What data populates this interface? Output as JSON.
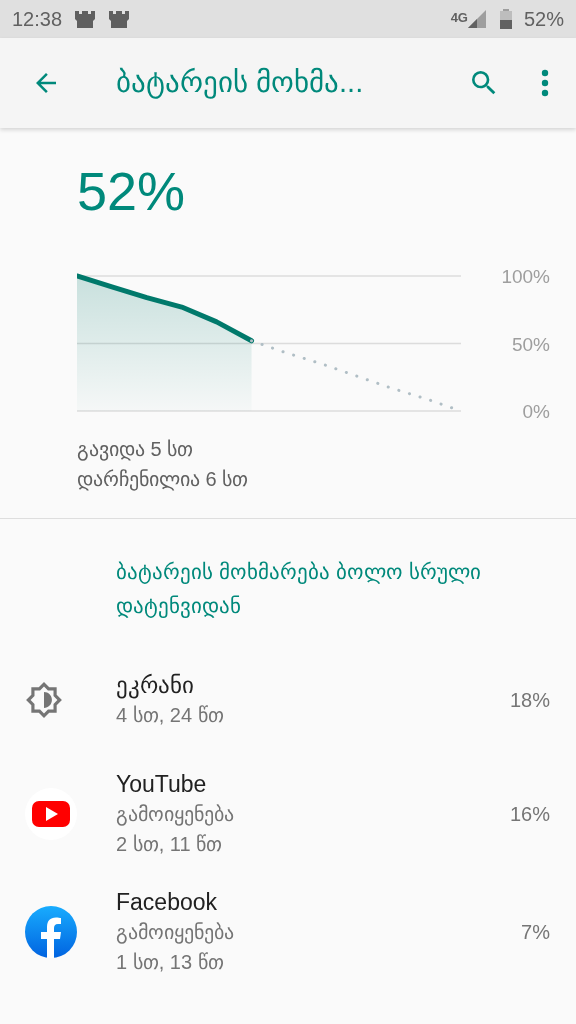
{
  "status_bar": {
    "time": "12:38",
    "network": "4G",
    "battery": "52%"
  },
  "app_bar": {
    "title": "ბატარეის მოხმა..."
  },
  "battery": {
    "percent": "52%",
    "chart_data": {
      "type": "line",
      "ylim": [
        0,
        100
      ],
      "yticks": [
        {
          "value": 100,
          "label": "100%"
        },
        {
          "value": 50,
          "label": "50%"
        },
        {
          "value": 0,
          "label": "0%"
        }
      ],
      "series": [
        {
          "color": "#00796b",
          "line_style": "solid",
          "values": [
            100,
            92,
            84,
            77,
            66,
            52,
            null,
            null,
            null,
            null,
            null,
            null
          ]
        },
        {
          "color": "#b0bec5",
          "line_style": "dotted",
          "values": [
            null,
            null,
            null,
            null,
            null,
            52,
            43,
            35,
            26,
            17,
            9,
            0
          ]
        }
      ]
    },
    "elapsed": "გავიდა 5 სთ",
    "remaining": "დარჩენილია 6 სთ"
  },
  "section_title": "ბატარეის მოხმარება ბოლო სრული დატენვიდან",
  "items": [
    {
      "kind": "screen",
      "name": "ეკრანი",
      "lines": [
        "4 სთ, 24 წთ"
      ],
      "percent": "18%"
    },
    {
      "kind": "youtube",
      "name": "YouTube",
      "lines": [
        "გამოიყენება",
        "2 სთ, 11 წთ"
      ],
      "percent": "16%"
    },
    {
      "kind": "facebook",
      "name": "Facebook",
      "lines": [
        "გამოიყენება",
        "1 სთ, 13 წთ"
      ],
      "percent": "7%"
    }
  ]
}
